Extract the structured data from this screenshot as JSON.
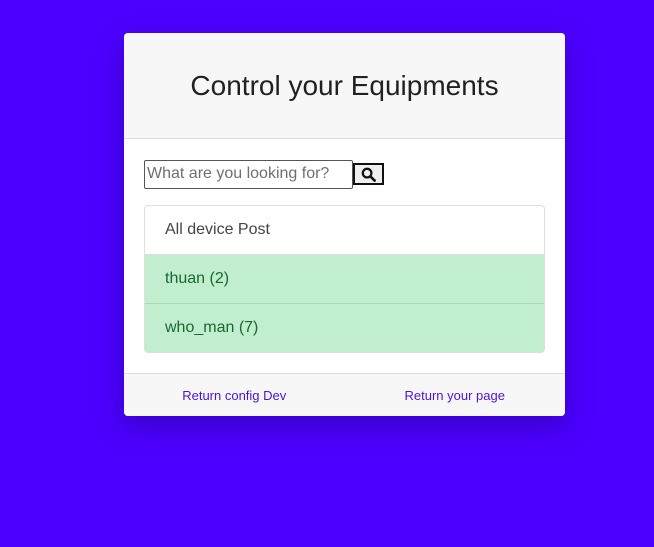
{
  "header": {
    "title": "Control your Equipments"
  },
  "search": {
    "placeholder": "What are you looking for?",
    "value": "",
    "button_icon": "search-icon"
  },
  "device_list": {
    "header": "All device Post",
    "items": [
      {
        "label": "thuan (2)"
      },
      {
        "label": "who_man (7)"
      }
    ],
    "item_background": "#c0eecf",
    "item_text_color": "#17692f"
  },
  "footer": {
    "links": [
      {
        "label": "Return config Dev"
      },
      {
        "label": "Return your page"
      }
    ]
  },
  "colors": {
    "page_background": "#4c00ff",
    "link": "#4b14d8"
  }
}
